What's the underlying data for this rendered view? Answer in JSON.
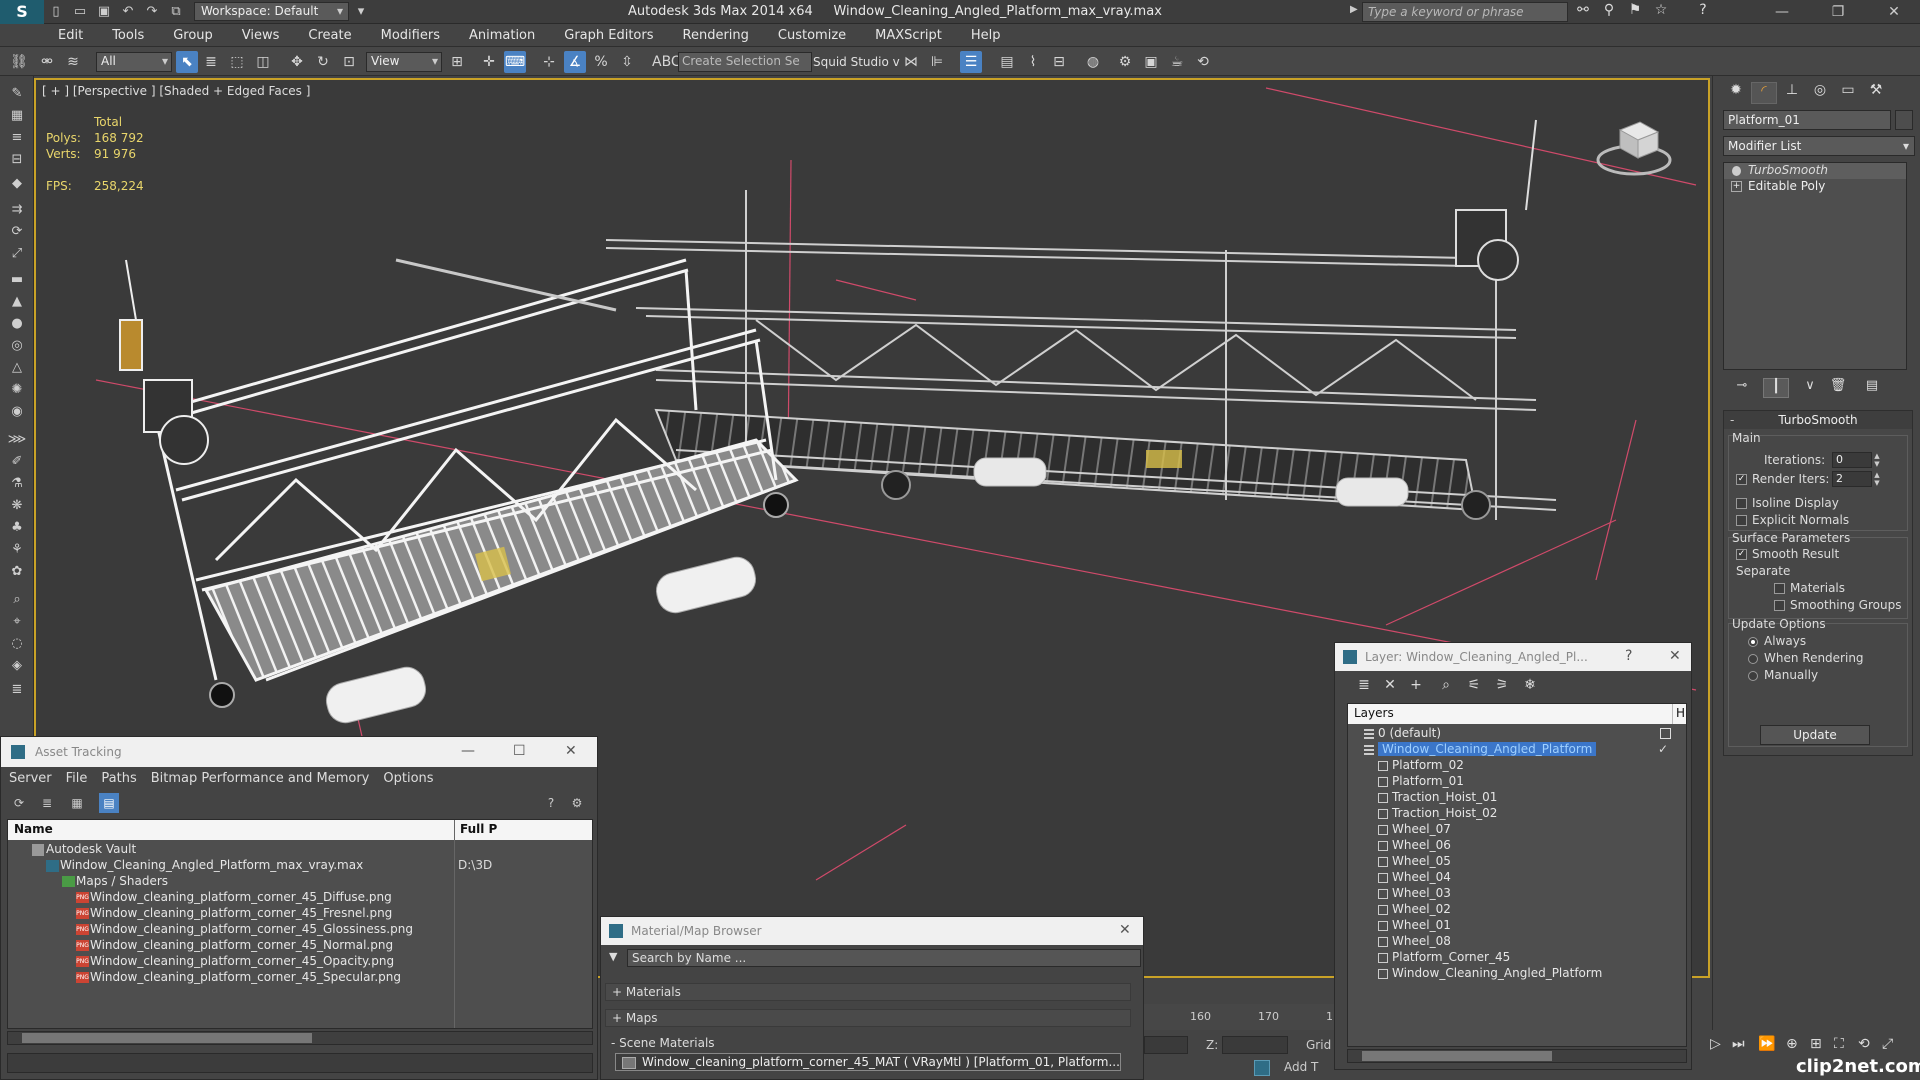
{
  "titlebar": {
    "workspace": "Workspace: Default",
    "app": "Autodesk 3ds Max  2014 x64",
    "file": "Window_Cleaning_Angled_Platform_max_vray.max",
    "search_placeholder": "Type a keyword or phrase"
  },
  "menu": [
    "Edit",
    "Tools",
    "Group",
    "Views",
    "Create",
    "Modifiers",
    "Animation",
    "Graph Editors",
    "Rendering",
    "Customize",
    "MAXScript",
    "Help"
  ],
  "toolbar": {
    "selection_filter": "All",
    "ref_coord": "View",
    "named_selection_placeholder": "Create Selection Se",
    "squid": "Squid Studio v"
  },
  "viewport": {
    "label": "[ + ] [Perspective ] [Shaded + Edged Faces ]",
    "stats_header": "Total",
    "polys_label": "Polys:",
    "polys_value": "168 792",
    "verts_label": "Verts:",
    "verts_value": "91 976",
    "fps_label": "FPS:",
    "fps_value": "258,224"
  },
  "command_panel": {
    "object_name": "Platform_01",
    "modifier_list": "Modifier List",
    "stack": [
      "TurboSmooth",
      "Editable Poly"
    ],
    "rollout_title": "TurboSmooth",
    "main_label": "Main",
    "iterations_label": "Iterations:",
    "iterations_value": "0",
    "render_iters_label": "Render Iters:",
    "render_iters_value": "2",
    "isoline_label": "Isoline Display",
    "explicit_label": "Explicit Normals",
    "surface_label": "Surface Parameters",
    "smooth_label": "Smooth Result",
    "separate_label": "Separate",
    "materials_label": "Materials",
    "smoothing_label": "Smoothing Groups",
    "update_options_label": "Update Options",
    "always_label": "Always",
    "when_rendering_label": "When Rendering",
    "manually_label": "Manually",
    "update_button": "Update"
  },
  "asset_tracking": {
    "title": "Asset Tracking",
    "menu": [
      "Server",
      "File",
      "Paths",
      "Bitmap Performance and Memory",
      "Options"
    ],
    "col_name": "Name",
    "col_path": "Full P",
    "rows": [
      {
        "name": "Autodesk Vault",
        "path": ""
      },
      {
        "name": "Window_Cleaning_Angled_Platform_max_vray.max",
        "path": "D:\\3D"
      },
      {
        "name": "Maps / Shaders",
        "path": ""
      },
      {
        "name": "Window_cleaning_platform_corner_45_Diffuse.png",
        "path": ""
      },
      {
        "name": "Window_cleaning_platform_corner_45_Fresnel.png",
        "path": ""
      },
      {
        "name": "Window_cleaning_platform_corner_45_Glossiness.png",
        "path": ""
      },
      {
        "name": "Window_cleaning_platform_corner_45_Normal.png",
        "path": ""
      },
      {
        "name": "Window_cleaning_platform_corner_45_Opacity.png",
        "path": ""
      },
      {
        "name": "Window_cleaning_platform_corner_45_Specular.png",
        "path": ""
      }
    ]
  },
  "material_browser": {
    "title": "Material/Map Browser",
    "search_placeholder": "Search by Name ...",
    "groups": [
      "+ Materials",
      "+ Maps",
      "- Scene Materials"
    ],
    "item": "Window_cleaning_platform_corner_45_MAT  ( VRayMtl )  [Platform_01, Platform..."
  },
  "timeline": {
    "ticks": [
      "160",
      "170",
      "1"
    ],
    "z_label": "Z:",
    "grid_label": "Grid",
    "add_label": "Add T"
  },
  "layer_dialog": {
    "title": "Layer: Window_Cleaning_Angled_Pl...",
    "help": "?",
    "col_layers": "Layers",
    "col_hide": "Hi",
    "rows": [
      {
        "name": "0 (default)",
        "type": "layer"
      },
      {
        "name": "Window_Cleaning_Angled_Platform",
        "type": "layer"
      },
      {
        "name": "Platform_02",
        "type": "object"
      },
      {
        "name": "Platform_01",
        "type": "object"
      },
      {
        "name": "Traction_Hoist_01",
        "type": "object"
      },
      {
        "name": "Traction_Hoist_02",
        "type": "object"
      },
      {
        "name": "Wheel_07",
        "type": "object"
      },
      {
        "name": "Wheel_06",
        "type": "object"
      },
      {
        "name": "Wheel_05",
        "type": "object"
      },
      {
        "name": "Wheel_04",
        "type": "object"
      },
      {
        "name": "Wheel_03",
        "type": "object"
      },
      {
        "name": "Wheel_02",
        "type": "object"
      },
      {
        "name": "Wheel_01",
        "type": "object"
      },
      {
        "name": "Wheel_08",
        "type": "object"
      },
      {
        "name": "Platform_Corner_45",
        "type": "object"
      },
      {
        "name": "Window_Cleaning_Angled_Platform",
        "type": "object"
      }
    ]
  },
  "watermark": "clip2net.com",
  "colors": {
    "viewport_border": "#c9a227",
    "stats": "#e9d66b",
    "selection": "#3b76c9",
    "active_tool": "#4a82c3"
  }
}
